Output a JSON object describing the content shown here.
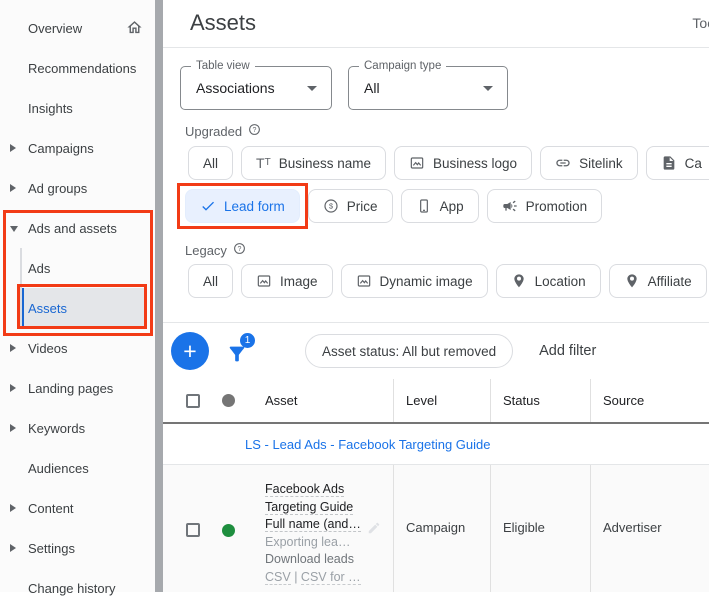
{
  "colors": {
    "accent": "#1a73e8",
    "highlight_red": "#f23b16",
    "status_green": "#1e8e3e"
  },
  "glyphs": {
    "plus": "+",
    "question": "?",
    "dollar": "$",
    "t_big": "T",
    "t_small": "T"
  },
  "sidebar": {
    "items": [
      {
        "label": "Overview"
      },
      {
        "label": "Recommendations"
      },
      {
        "label": "Insights"
      },
      {
        "label": "Campaigns"
      },
      {
        "label": "Ad groups"
      },
      {
        "label": "Ads and assets"
      },
      {
        "label": "Ads"
      },
      {
        "label": "Assets"
      },
      {
        "label": "Videos"
      },
      {
        "label": "Landing pages"
      },
      {
        "label": "Keywords"
      },
      {
        "label": "Audiences"
      },
      {
        "label": "Content"
      },
      {
        "label": "Settings"
      },
      {
        "label": "Change history"
      }
    ]
  },
  "header": {
    "title": "Assets",
    "right_text": "Too"
  },
  "filters": {
    "table_view": {
      "label": "Table view",
      "value": "Associations"
    },
    "campaign_type": {
      "label": "Campaign type",
      "value": "All"
    }
  },
  "upgraded": {
    "label": "Upgraded",
    "chips": [
      "All",
      "Business name",
      "Business logo",
      "Sitelink",
      "Ca",
      "Lead form",
      "Price",
      "App",
      "Promotion"
    ]
  },
  "legacy": {
    "label": "Legacy",
    "chips": [
      "All",
      "Image",
      "Dynamic image",
      "Location",
      "Affiliate"
    ]
  },
  "toolbar": {
    "filter_count": "1",
    "status_filter": "Asset status: All but removed",
    "add_filter": "Add filter"
  },
  "table": {
    "columns": [
      "Asset",
      "Level",
      "Status",
      "Source"
    ],
    "group": {
      "link": "LS - Lead Ads - Facebook Targeting Guide"
    },
    "row": {
      "line1": "Facebook Ads",
      "line2": "Targeting Guide",
      "line3": "Full name (and…",
      "line4": "Exporting lea…",
      "line5": "Download leads",
      "csv_a": "CSV",
      "csv_sep": "|",
      "csv_b": "CSV for …",
      "level": "Campaign",
      "status": "Eligible",
      "source": "Advertiser"
    }
  }
}
